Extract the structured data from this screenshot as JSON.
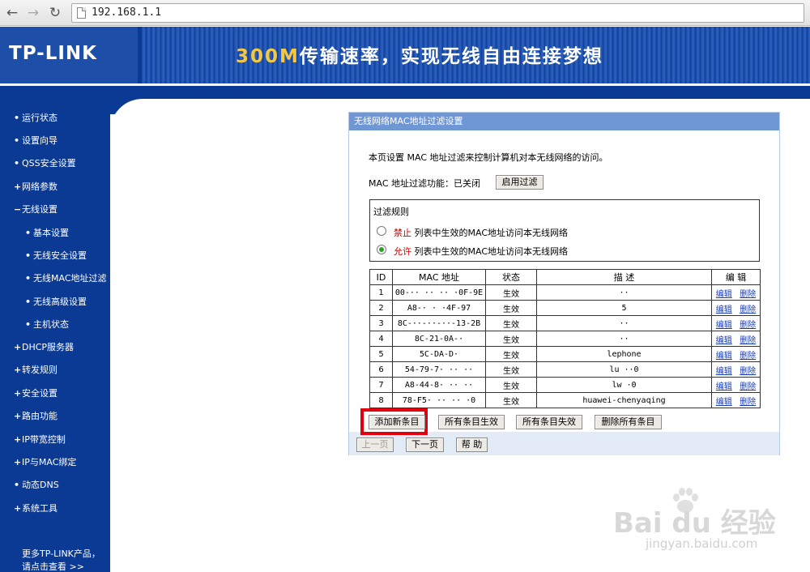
{
  "browser": {
    "url": "192.168.1.1",
    "back_glyph": "←",
    "forward_glyph": "→",
    "reload_glyph": "↻"
  },
  "header": {
    "logo": "TP-LINK",
    "slogan_highlight": "300M",
    "slogan_rest": "传输速率，实现无线自由连接梦想"
  },
  "sidebar": {
    "items": [
      {
        "icon": "•",
        "label": "运行状态"
      },
      {
        "icon": "•",
        "label": "设置向导"
      },
      {
        "icon": "•",
        "label": "QSS安全设置"
      },
      {
        "icon": "+",
        "label": "网络参数"
      },
      {
        "icon": "−",
        "label": "无线设置"
      },
      {
        "icon": "•",
        "label": "基本设置"
      },
      {
        "icon": "•",
        "label": "无线安全设置"
      },
      {
        "icon": "•",
        "label": "无线MAC地址过滤"
      },
      {
        "icon": "•",
        "label": "无线高级设置"
      },
      {
        "icon": "•",
        "label": "主机状态"
      },
      {
        "icon": "+",
        "label": "DHCP服务器"
      },
      {
        "icon": "+",
        "label": "转发规则"
      },
      {
        "icon": "+",
        "label": "安全设置"
      },
      {
        "icon": "+",
        "label": "路由功能"
      },
      {
        "icon": "+",
        "label": "IP带宽控制"
      },
      {
        "icon": "+",
        "label": "IP与MAC绑定"
      },
      {
        "icon": "•",
        "label": "动态DNS"
      },
      {
        "icon": "+",
        "label": "系统工具"
      }
    ],
    "footer_line1": "更多TP-LINK产品，",
    "footer_line2": "请点击查看 >>"
  },
  "panel": {
    "title": "无线网络MAC地址过滤设置",
    "description": "本页设置 MAC 地址过滤来控制计算机对本无线网络的访问。",
    "filter_status": "MAC 地址过滤功能：已关闭",
    "enable_filter_label": "启用过滤",
    "rules": {
      "title": "过滤规则",
      "deny_keyword": "禁止",
      "deny_text": " 列表中生效的MAC地址访问本无线网络",
      "allow_keyword": "允许",
      "allow_text": " 列表中生效的MAC地址访问本无线网络",
      "selected": "allow"
    },
    "table": {
      "headers": [
        "ID",
        "MAC 地址",
        "状态",
        "描 述",
        "编 辑"
      ],
      "rows": [
        {
          "id": "1",
          "mac": "00-·· ·· ·· ·0F-9E",
          "state": "生效",
          "desc": "··",
          "edit": "编辑",
          "del": "删除"
        },
        {
          "id": "2",
          "mac": "A8-·  · ·4F-97",
          "state": "生效",
          "desc": "5",
          "edit": "编辑",
          "del": "删除"
        },
        {
          "id": "3",
          "mac": "8C-··-··-··-13-2B",
          "state": "生效",
          "desc": "··",
          "edit": "编辑",
          "del": "删除"
        },
        {
          "id": "4",
          "mac": "8C-21-0A-·",
          "state": "生效",
          "desc": "··",
          "edit": "编辑",
          "del": "删除"
        },
        {
          "id": "5",
          "mac": "5C-DA-D·",
          "state": "生效",
          "desc": "lephone",
          "edit": "编辑",
          "del": "删除"
        },
        {
          "id": "6",
          "mac": "54-79-7·  ·· ··",
          "state": "生效",
          "desc": "lu      ··0",
          "edit": "编辑",
          "del": "删除"
        },
        {
          "id": "7",
          "mac": "A8-44-8· ·· ··",
          "state": "生效",
          "desc": "lw       ·0",
          "edit": "编辑",
          "del": "删除"
        },
        {
          "id": "8",
          "mac": "78-F5· ·· ·· ·0",
          "state": "生效",
          "desc": "huawei-chenyaqing",
          "edit": "编辑",
          "del": "删除"
        }
      ]
    },
    "buttons": {
      "add": "添加新条目",
      "enable_all": "所有条目生效",
      "disable_all": "所有条目失效",
      "delete_all": "删除所有条目",
      "prev": "上一页",
      "next": "下一页",
      "help": "帮 助"
    }
  },
  "watermark": {
    "brand": "Bai  du 经验",
    "site": "jingyan.baidu.com"
  },
  "colors": {
    "nav_blue": "#0b3a94",
    "panel_title": "#6f97d6",
    "highlight_red": "#e0000e",
    "keyword_red": "#cc0000"
  }
}
